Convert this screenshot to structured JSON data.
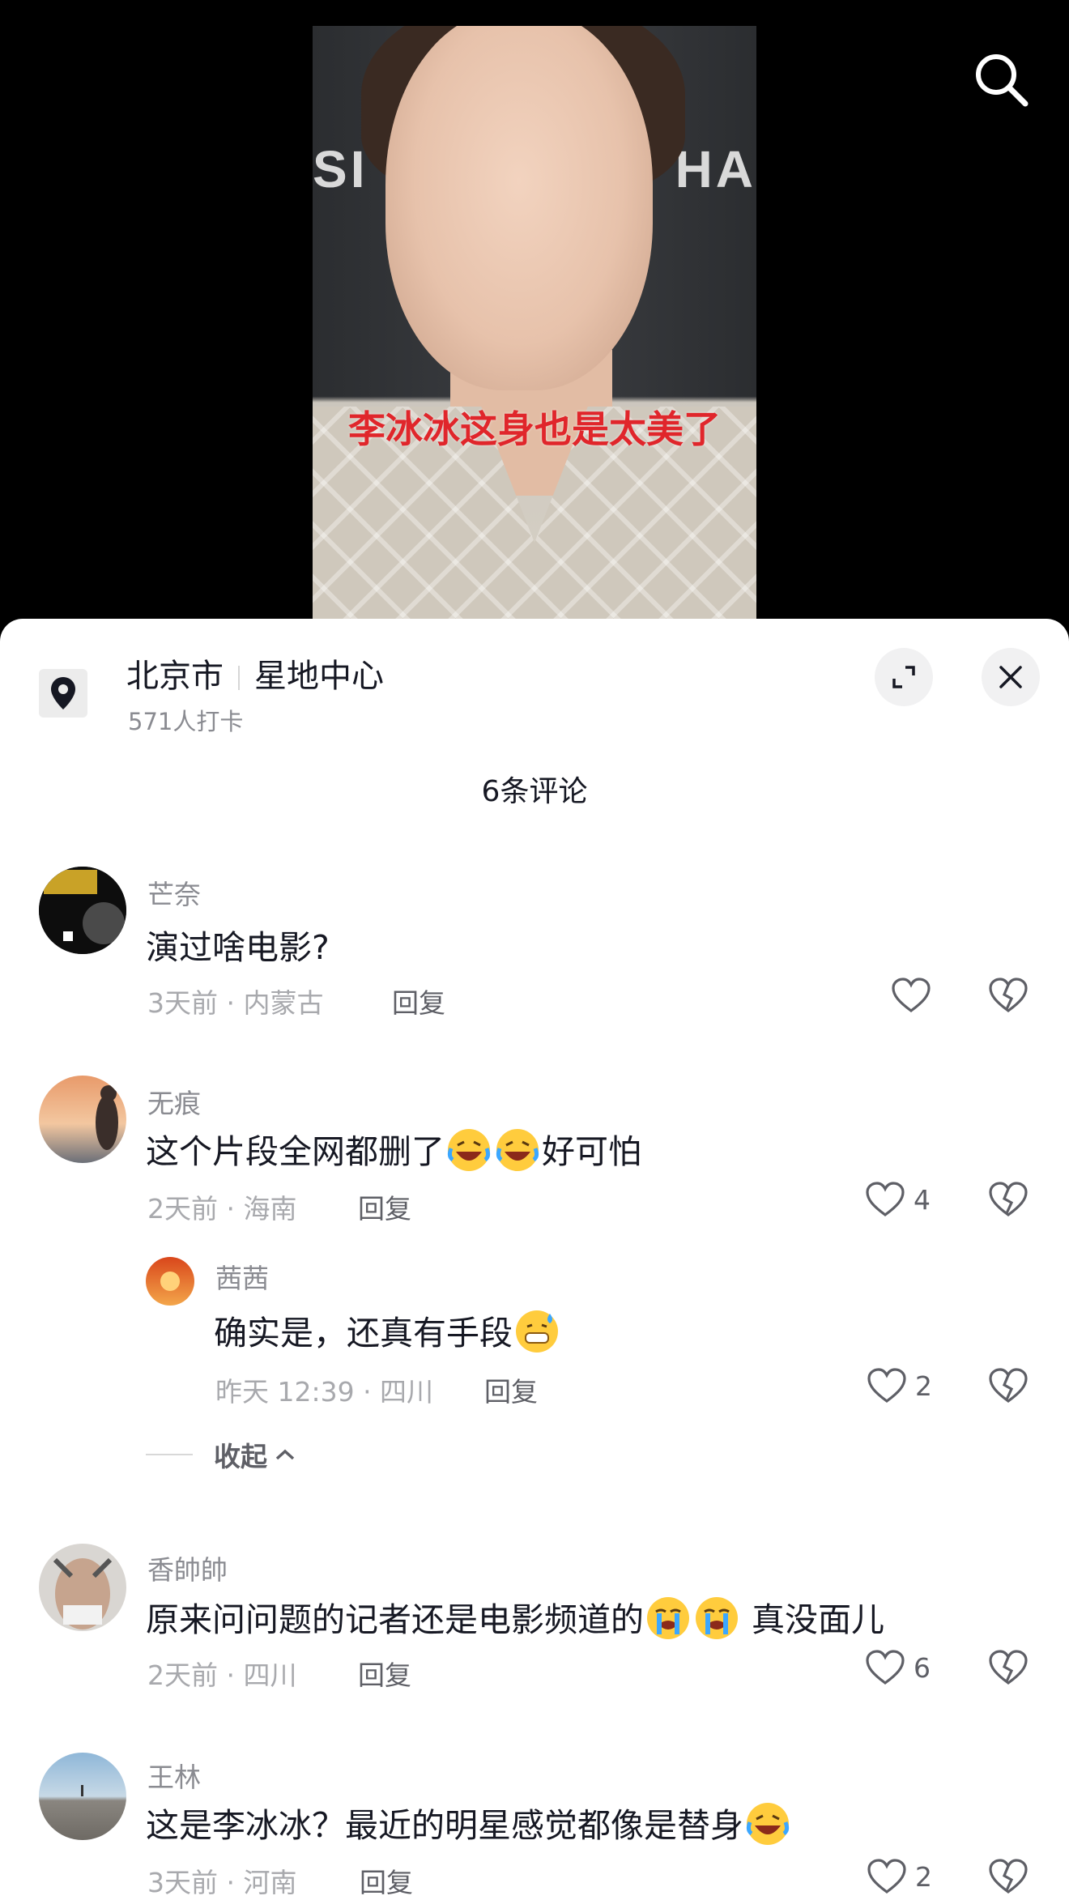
{
  "video": {
    "caption": "李冰冰这身也是太美了",
    "backdrop_left": "SI",
    "backdrop_right": "HA"
  },
  "icons": {
    "search": "search-icon",
    "location": "map-pin-icon",
    "expand": "expand-icon",
    "close": "close-icon",
    "like": "heart-icon",
    "dislike": "broken-heart-icon",
    "collapse": "chevron-up-icon"
  },
  "location": {
    "city": "北京市",
    "place": "星地中心",
    "checkins": "571人打卡"
  },
  "comments_header": "6条评论",
  "reply_label": "回复",
  "comments": [
    {
      "user": "芒奈",
      "text": "演过啥电影?",
      "meta": "3天前 · 内蒙古",
      "likes": ""
    },
    {
      "user": "无痕",
      "text_before": "这个片段全网都删了",
      "text_after": "好可怕",
      "meta": "2天前 · 海南",
      "likes": "4",
      "replies": [
        {
          "user": "茜茜",
          "text": "确实是，还真有手段",
          "meta": "昨天 12:39 · 四川",
          "likes": "2"
        }
      ],
      "collapse_label": "收起"
    },
    {
      "user": "香帥帥",
      "text_before": "原来问问题的记者还是电影频道的",
      "text_after": " 真没面儿",
      "meta": "2天前 · 四川",
      "likes": "6"
    },
    {
      "user": "王林",
      "text": "这是李冰冰？最近的明星感觉都像是替身",
      "meta": "3天前 · 河南",
      "likes": "2"
    }
  ],
  "colors": {
    "caption_red": "#e0262b",
    "text_primary": "#161823",
    "text_secondary": "#8a8b91"
  }
}
